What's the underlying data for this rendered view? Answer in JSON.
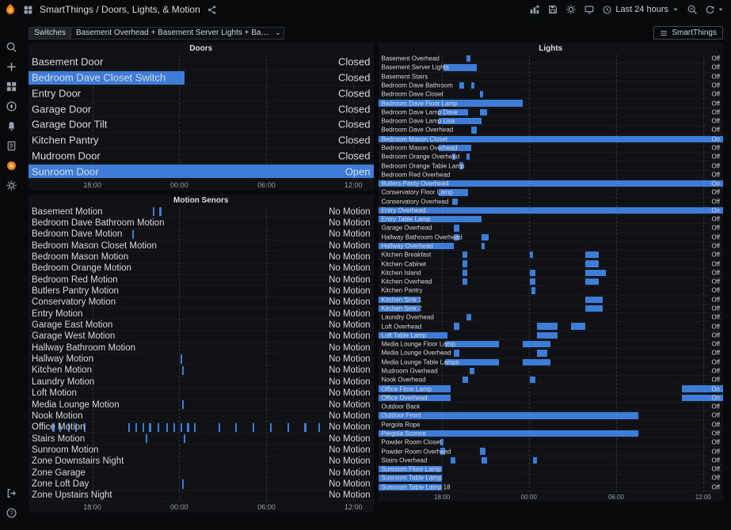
{
  "header": {
    "title": "SmartThings / Doors, Lights, & Motion"
  },
  "toolbar": {
    "time_range": "Last 24 hours",
    "icons": [
      "add-panel",
      "save-dashboard",
      "dashboard-settings",
      "cycle-view",
      "time-range",
      "zoom-out",
      "refresh",
      "refresh-interval-caret"
    ]
  },
  "sidebar": {
    "icons": [
      "search",
      "plus",
      "dashboards",
      "explore",
      "alerting",
      "docs",
      "smartthings-plugin",
      "settings"
    ],
    "bottom_icons": [
      "sign-out",
      "help"
    ]
  },
  "variables": {
    "label": "Switches",
    "value": "Basement Overhead + Basement Server Lights + Basement Stairs + Bedro..."
  },
  "smartthings_button": "SmartThings",
  "axis_ticks": [
    "18:00",
    "00:00",
    "06:00",
    "12:00"
  ],
  "panels": {
    "doors": {
      "title": "Doors",
      "rows": [
        {
          "name": "Basement Door",
          "value": "Closed",
          "bars": []
        },
        {
          "name": "Bedroom Dave Closet Switch",
          "value": "Closed",
          "bars": [
            [
              0,
              0.452
            ]
          ]
        },
        {
          "name": "Entry Door",
          "value": "Closed",
          "bars": []
        },
        {
          "name": "Garage Door",
          "value": "Closed",
          "bars": []
        },
        {
          "name": "Garage Door Tilt",
          "value": "Closed",
          "bars": []
        },
        {
          "name": "Kitchen Pantry",
          "value": "Closed",
          "bars": []
        },
        {
          "name": "Mudroom Door",
          "value": "Closed",
          "bars": []
        },
        {
          "name": "Sunroom Door",
          "value": "Open",
          "bars": [
            [
              0,
              1
            ]
          ]
        }
      ]
    },
    "motion": {
      "title": "Motion Senors",
      "rows": [
        {
          "name": "Basement Motion",
          "value": "No Motion",
          "bars": [
            [
              0.36,
              0.365
            ],
            [
              0.38,
              0.385
            ]
          ]
        },
        {
          "name": "Bedroom Dave Bathroom Motion",
          "value": "No Motion",
          "bars": []
        },
        {
          "name": "Bedroom Dave Motion",
          "value": "No Motion",
          "bars": [
            [
              0.3,
              0.305
            ]
          ]
        },
        {
          "name": "Bedroom Mason Closet Motion",
          "value": "No Motion",
          "bars": []
        },
        {
          "name": "Bedroom Mason Motion",
          "value": "No Motion",
          "bars": []
        },
        {
          "name": "Bedroom Orange Motion",
          "value": "No Motion",
          "bars": []
        },
        {
          "name": "Bedroom Red Motion",
          "value": "No Motion",
          "bars": []
        },
        {
          "name": "Butlers Pantry Motion",
          "value": "No Motion",
          "bars": []
        },
        {
          "name": "Conservatory Motion",
          "value": "No Motion",
          "bars": []
        },
        {
          "name": "Entry Motion",
          "value": "No Motion",
          "bars": []
        },
        {
          "name": "Garage East Motion",
          "value": "No Motion",
          "bars": []
        },
        {
          "name": "Garage West Motion",
          "value": "No Motion",
          "bars": []
        },
        {
          "name": "Hallway Bathroom Motion",
          "value": "No Motion",
          "bars": []
        },
        {
          "name": "Hallway Motion",
          "value": "No Motion",
          "bars": [
            [
              0.44,
              0.445
            ]
          ]
        },
        {
          "name": "Kitchen Motion",
          "value": "No Motion",
          "bars": [
            [
              0.445,
              0.45
            ]
          ]
        },
        {
          "name": "Laundry Motion",
          "value": "No Motion",
          "bars": []
        },
        {
          "name": "Loft Motion",
          "value": "No Motion",
          "bars": []
        },
        {
          "name": "Media Lounge Motion",
          "value": "No Motion",
          "bars": [
            [
              0.445,
              0.45
            ]
          ]
        },
        {
          "name": "Nook Motion",
          "value": "No Motion",
          "bars": []
        },
        {
          "name": "Office Motion",
          "value": "No Motion",
          "bars": [
            [
              0.07,
              0.075
            ],
            [
              0.09,
              0.095
            ],
            [
              0.115,
              0.12
            ],
            [
              0.135,
              0.14
            ],
            [
              0.16,
              0.165
            ],
            [
              0.29,
              0.295
            ],
            [
              0.31,
              0.315
            ],
            [
              0.33,
              0.335
            ],
            [
              0.35,
              0.355
            ],
            [
              0.375,
              0.38
            ],
            [
              0.4,
              0.405
            ],
            [
              0.42,
              0.425
            ],
            [
              0.44,
              0.445
            ],
            [
              0.46,
              0.465
            ],
            [
              0.48,
              0.485
            ],
            [
              0.55,
              0.555
            ],
            [
              0.6,
              0.605
            ],
            [
              0.65,
              0.655
            ],
            [
              0.7,
              0.705
            ],
            [
              0.75,
              0.755
            ],
            [
              0.8,
              0.805
            ],
            [
              0.84,
              0.845
            ]
          ]
        },
        {
          "name": "Stairs Motion",
          "value": "No Motion",
          "bars": [
            [
              0.34,
              0.345
            ],
            [
              0.45,
              0.455
            ]
          ]
        },
        {
          "name": "Sunroom Motion",
          "value": "No Motion",
          "bars": []
        },
        {
          "name": "Zone Downstairs Night",
          "value": "No Motion",
          "bars": []
        },
        {
          "name": "Zone Garage",
          "value": "No Motion",
          "bars": []
        },
        {
          "name": "Zone Loft Day",
          "value": "No Motion",
          "bars": [
            [
              0.445,
              0.45
            ]
          ]
        },
        {
          "name": "Zone Upstairs Night",
          "value": "No Motion",
          "bars": []
        }
      ]
    },
    "lights": {
      "title": "Lights",
      "rows": [
        {
          "name": "Basement Overhead",
          "value": "Off",
          "bars": [
            [
              0.255,
              0.268
            ]
          ]
        },
        {
          "name": "Basement Server Lights",
          "value": "Off",
          "bars": [
            [
              0.19,
              0.285
            ]
          ]
        },
        {
          "name": "Basement Stairs",
          "value": "Off",
          "bars": []
        },
        {
          "name": "Bedroom Dave Bathroom",
          "value": "Off",
          "bars": [
            [
              0.235,
              0.25
            ],
            [
              0.27,
              0.278
            ]
          ]
        },
        {
          "name": "Bedroom Dave Closet",
          "value": "Off",
          "bars": [
            [
              0.295,
              0.305
            ]
          ]
        },
        {
          "name": "Bedroom Dave Floor Lamp",
          "value": "Off",
          "bars": [
            [
              0,
              0.42
            ]
          ]
        },
        {
          "name": "Bedroom Dave Lamp Dave",
          "value": "Off",
          "bars": [
            [
              0.175,
              0.26
            ],
            [
              0.295,
              0.315
            ]
          ]
        },
        {
          "name": "Bedroom Dave Lamp Lisa",
          "value": "Off",
          "bars": [
            [
              0.175,
              0.3
            ]
          ]
        },
        {
          "name": "Bedroom Dave Overhead",
          "value": "Off",
          "bars": [
            [
              0.27,
              0.285
            ]
          ]
        },
        {
          "name": "Bedroom Mason Closet",
          "value": "On",
          "bars": [
            [
              0,
              1
            ]
          ]
        },
        {
          "name": "Bedroom Mason Overhead",
          "value": "Off",
          "bars": [
            [
              0.175,
              0.27
            ]
          ]
        },
        {
          "name": "Bedroom Orange Overhead",
          "value": "Off",
          "bars": [
            [
              0.215,
              0.225
            ],
            [
              0.255,
              0.265
            ]
          ]
        },
        {
          "name": "Bedroom Orange Table Lamp",
          "value": "Off",
          "bars": [
            [
              0.235,
              0.248
            ]
          ]
        },
        {
          "name": "Bedroom Red Overhead",
          "value": "Off",
          "bars": []
        },
        {
          "name": "Butlers Panty Overhead",
          "value": "On",
          "bars": [
            [
              0,
              1
            ]
          ]
        },
        {
          "name": "Conservatory Floor Lamp",
          "value": "Off",
          "bars": [
            [
              0.175,
              0.26
            ]
          ]
        },
        {
          "name": "Conservatory Overhead",
          "value": "Off",
          "bars": [
            [
              0.215,
              0.23
            ]
          ]
        },
        {
          "name": "Entry Overhead",
          "value": "On",
          "bars": [
            [
              0,
              1
            ]
          ]
        },
        {
          "name": "Entry Table Lamp",
          "value": "Off",
          "bars": [
            [
              0,
              0.3
            ]
          ]
        },
        {
          "name": "Garage Overhead",
          "value": "Off",
          "bars": [
            [
              0.22,
              0.235
            ]
          ]
        },
        {
          "name": "Hallway Bathroom Overhead",
          "value": "Off",
          "bars": [
            [
              0.22,
              0.235
            ],
            [
              0.3,
              0.32
            ]
          ]
        },
        {
          "name": "Hallway Overhead",
          "value": "Off",
          "bars": [
            [
              0,
              0.22
            ],
            [
              0.3,
              0.31
            ]
          ]
        },
        {
          "name": "Kitchen Breakfast",
          "value": "Off",
          "bars": [
            [
              0.245,
              0.258
            ],
            [
              0.44,
              0.45
            ],
            [
              0.6,
              0.64
            ]
          ]
        },
        {
          "name": "Kitchen Cabinet",
          "value": "Off",
          "bars": [
            [
              0.245,
              0.258
            ],
            [
              0.6,
              0.64
            ]
          ]
        },
        {
          "name": "Kitchen Island",
          "value": "Off",
          "bars": [
            [
              0.245,
              0.258
            ],
            [
              0.44,
              0.455
            ],
            [
              0.6,
              0.66
            ]
          ]
        },
        {
          "name": "Kitchen Overhead",
          "value": "Off",
          "bars": [
            [
              0.245,
              0.258
            ],
            [
              0.44,
              0.455
            ],
            [
              0.6,
              0.64
            ]
          ]
        },
        {
          "name": "Kitchen Pantry",
          "value": "Off",
          "bars": [
            [
              0.445,
              0.455
            ]
          ]
        },
        {
          "name": "Kitchen Sink 1",
          "value": "Off",
          "bars": [
            [
              0,
              0.12
            ],
            [
              0.6,
              0.65
            ]
          ]
        },
        {
          "name": "Kitchen Sink 2",
          "value": "Off",
          "bars": [
            [
              0,
              0.12
            ],
            [
              0.6,
              0.65
            ]
          ]
        },
        {
          "name": "Laundry Overhead",
          "value": "Off",
          "bars": [
            [
              0.255,
              0.27
            ]
          ]
        },
        {
          "name": "Loft Overhead",
          "value": "Off",
          "bars": [
            [
              0.22,
              0.235
            ],
            [
              0.46,
              0.52
            ],
            [
              0.56,
              0.6
            ]
          ]
        },
        {
          "name": "Loft Table Lamp",
          "value": "Off",
          "bars": [
            [
              0,
              0.2
            ],
            [
              0.46,
              0.52
            ]
          ]
        },
        {
          "name": "Media Lounge Floor Lamp",
          "value": "Off",
          "bars": [
            [
              0.195,
              0.35
            ],
            [
              0.42,
              0.5
            ]
          ]
        },
        {
          "name": "Media Lounge Overhead",
          "value": "Off",
          "bars": [
            [
              0.22,
              0.235
            ],
            [
              0.46,
              0.49
            ]
          ]
        },
        {
          "name": "Media Lounge Table Lamps",
          "value": "Off",
          "bars": [
            [
              0.195,
              0.35
            ],
            [
              0.42,
              0.5
            ]
          ]
        },
        {
          "name": "Mudroom Overhead",
          "value": "Off",
          "bars": [
            [
              0.265,
              0.28
            ]
          ]
        },
        {
          "name": "Nook Overhead",
          "value": "Off",
          "bars": [
            [
              0.245,
              0.26
            ],
            [
              0.44,
              0.455
            ]
          ]
        },
        {
          "name": "Office Floor Lamp",
          "value": "On",
          "bars": [
            [
              0,
              0.21
            ],
            [
              0.88,
              1
            ]
          ]
        },
        {
          "name": "Office Overhead",
          "value": "On",
          "bars": [
            [
              0,
              0.21
            ],
            [
              0.88,
              1
            ]
          ]
        },
        {
          "name": "Outdoor Back",
          "value": "Off",
          "bars": []
        },
        {
          "name": "Outdoor Front",
          "value": "Off",
          "bars": [
            [
              0,
              0.755
            ]
          ]
        },
        {
          "name": "Pergola Rope",
          "value": "Off",
          "bars": []
        },
        {
          "name": "Pergola Sconce",
          "value": "Off",
          "bars": [
            [
              0,
              0.755
            ]
          ]
        },
        {
          "name": "Powder Room Closet",
          "value": "Off",
          "bars": [
            [
              0.18,
              0.19
            ]
          ]
        },
        {
          "name": "Powder Room Overhead",
          "value": "Off",
          "bars": [
            [
              0.18,
              0.195
            ],
            [
              0.295,
              0.31
            ]
          ]
        },
        {
          "name": "Stairs Overhead",
          "value": "Off",
          "bars": [
            [
              0.21,
              0.225
            ],
            [
              0.3,
              0.315
            ],
            [
              0.45,
              0.46
            ]
          ]
        },
        {
          "name": "Sunroom Floor Lamp",
          "value": "Off",
          "bars": [
            [
              0,
              0.185
            ]
          ]
        },
        {
          "name": "Sunroom Table Lamp",
          "value": "Off",
          "bars": [
            [
              0,
              0.185
            ]
          ]
        },
        {
          "name": "Sunroom Table Lamp 18",
          "value": "Off",
          "bars": [
            [
              0,
              0.185
            ]
          ]
        }
      ]
    }
  }
}
